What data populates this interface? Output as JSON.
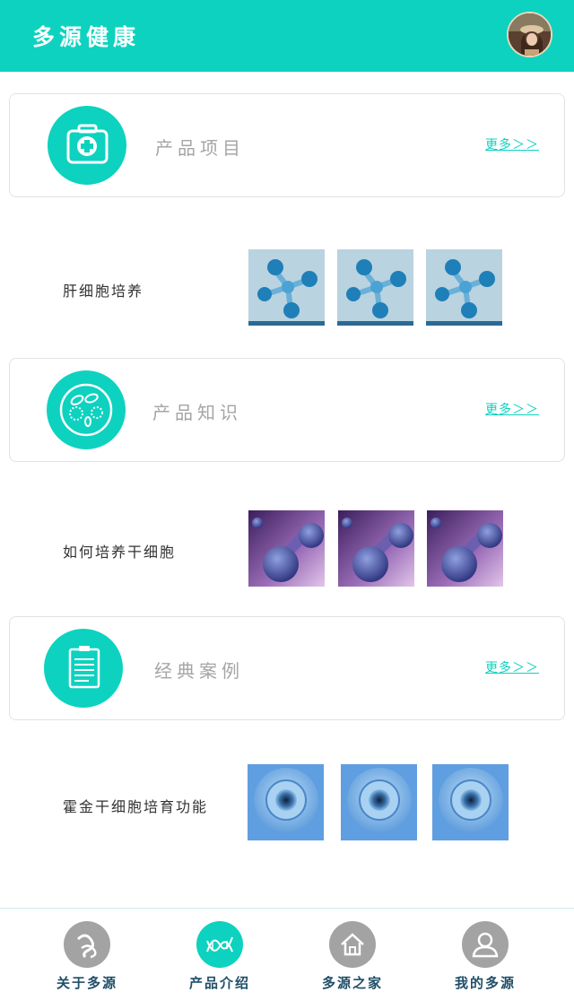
{
  "header": {
    "title": "多源健康"
  },
  "sections": [
    {
      "title": "产品项目",
      "more": "更多＞＞",
      "icon": "medical-kit-icon",
      "item": "肝细胞培养"
    },
    {
      "title": "产品知识",
      "more": "更多＞＞",
      "icon": "cells-icon",
      "item": "如何培养干细胞"
    },
    {
      "title": "经典案例",
      "more": "更多＞＞",
      "icon": "clipboard-icon",
      "item": "霍金干细胞培育功能"
    }
  ],
  "tabs": [
    {
      "label": "关于多源",
      "icon": "logo-icon",
      "active": false
    },
    {
      "label": "产品介绍",
      "icon": "dna-icon",
      "active": true
    },
    {
      "label": "多源之家",
      "icon": "home-icon",
      "active": false
    },
    {
      "label": "我的多源",
      "icon": "user-icon",
      "active": false
    }
  ],
  "colors": {
    "accent": "#0dd2bf",
    "inactive_tab": "#a3a3a3",
    "tab_label": "#1f4e67"
  }
}
